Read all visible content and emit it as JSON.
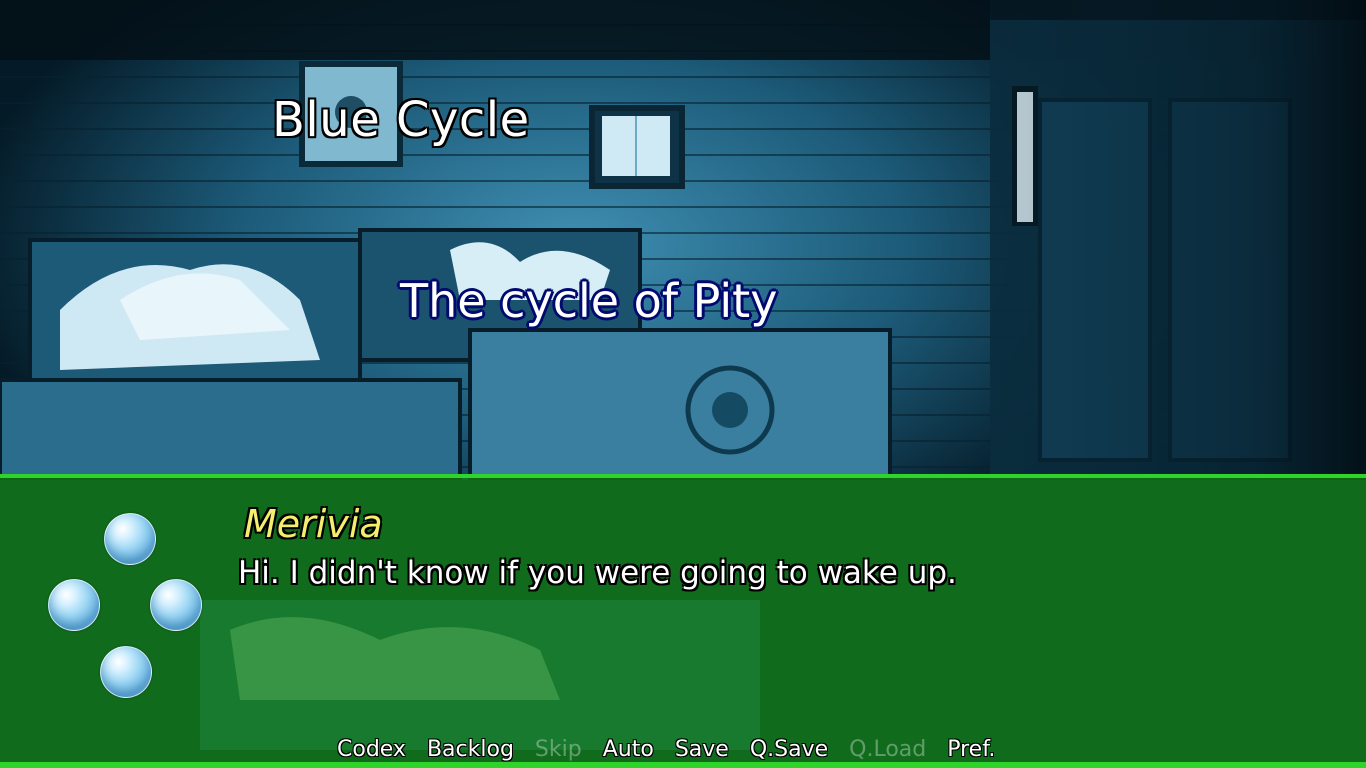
{
  "scene": {
    "chapter_title": "Blue Cycle",
    "cycle_subtitle": "The cycle of Pity"
  },
  "dialogue": {
    "speaker": "Merivia",
    "text": "Hi. I didn't know if you were going to wake up."
  },
  "quick_menu": {
    "items": [
      {
        "label": "Codex",
        "enabled": true
      },
      {
        "label": "Backlog",
        "enabled": true
      },
      {
        "label": "Skip",
        "enabled": false
      },
      {
        "label": "Auto",
        "enabled": true
      },
      {
        "label": "Save",
        "enabled": true
      },
      {
        "label": "Q.Save",
        "enabled": true
      },
      {
        "label": "Q.Load",
        "enabled": false
      },
      {
        "label": "Pref.",
        "enabled": true
      }
    ]
  },
  "colors": {
    "dialogue_bg": "#12820c",
    "dialogue_border": "#2fd42a",
    "speaker_name": "#f4ee6e",
    "subtitle_outline": "#000a6e"
  }
}
